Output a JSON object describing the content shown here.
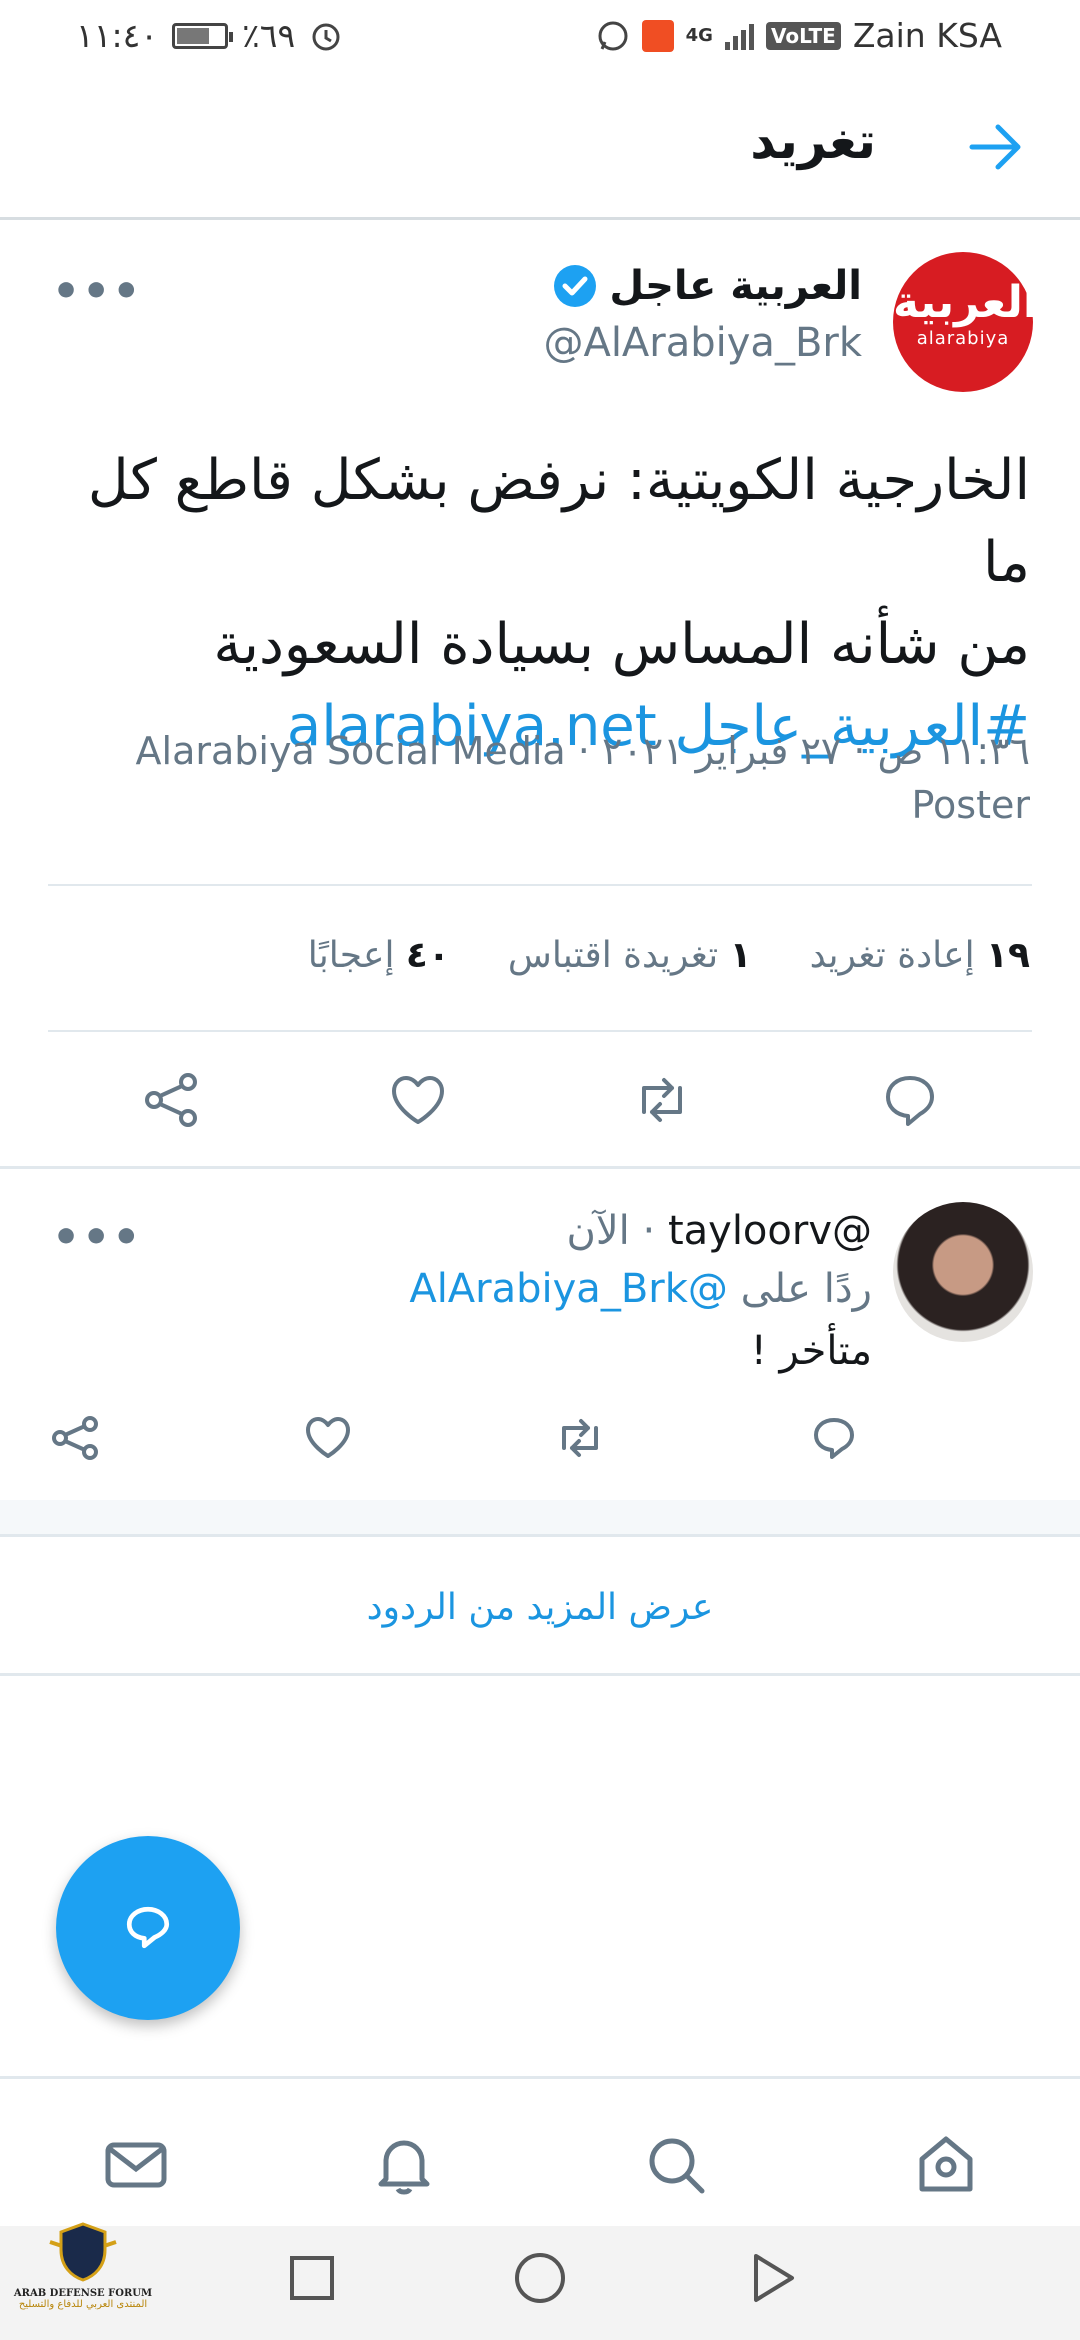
{
  "status_bar": {
    "time": "١١:٤٠",
    "battery": "٪٦٩",
    "battery_level": 0.69,
    "network": "4G",
    "volte": "VoLTE",
    "carrier": "Zain KSA"
  },
  "header": {
    "title": "تغريد"
  },
  "tweet": {
    "avatar_text_ar": "العربية",
    "avatar_text_en": "alarabiya",
    "name": "العربية عاجل",
    "handle": "@AlArabiya_Brk",
    "text_line1": "الخارجية الكويتية: نرفض بشكل قاطع كل ما",
    "text_line2": "من شأنه المساس بسيادة السعودية",
    "hashtag": "#العربية_عاجل",
    "link": "alarabiya.net",
    "meta_line1": "١١:٣٦ ص · ٢٧ فبراير ٢٠٢١ · Alarabiya Social Media",
    "meta_line2": "Poster",
    "stats": {
      "retweets_count": "١٩",
      "retweets_label": "إعادة تغريد",
      "quotes_count": "١",
      "quotes_label": "تغريدة اقتباس",
      "likes_count": "٤٠",
      "likes_label": "إعجابًا"
    }
  },
  "reply": {
    "handle": "@tayloorv",
    "time": "الآن",
    "replying_prefix": "ردًا على",
    "replying_to": "@AlArabiya_Brk",
    "text": "متأخر !"
  },
  "more_replies": "عرض المزيد من الردود",
  "watermark": {
    "line1": "ARAB DEFENSE FORUM",
    "line2": "المنتدى العربي للدفاع والتسليح"
  },
  "colors": {
    "accent": "#1da1f2",
    "link": "#1b95e0",
    "muted": "#657786",
    "brand_red": "#d71c22"
  }
}
